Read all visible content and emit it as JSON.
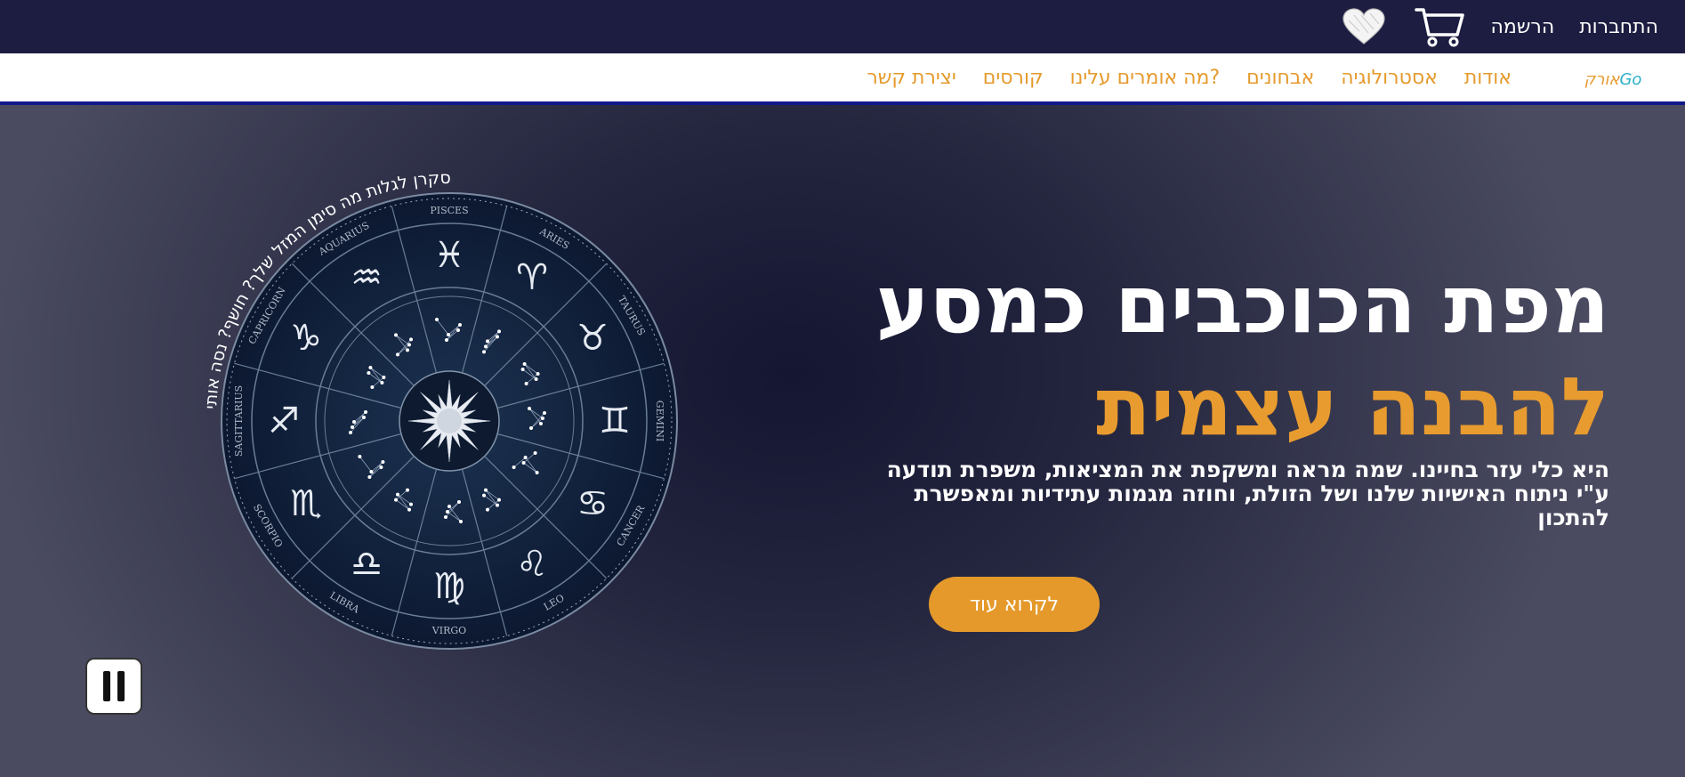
{
  "topbar": {
    "login": "התחברות",
    "register": "הרשמה",
    "cart_icon": "cart-icon",
    "heart_icon": "heart-icon"
  },
  "navbar": {
    "logo_part1": "אורק",
    "logo_part2": "Go",
    "items": [
      "אודות",
      "אסטרולוגיה",
      "אבחונים",
      "מה אומרים עלינו?",
      "קורסים",
      "יצירת קשר"
    ]
  },
  "hero": {
    "title_line1": "מפת הכוכבים כמסע",
    "title_line2": "להבנה עצמית",
    "description": "היא כלי עזר בחיינו. שמה מראה ומשקפת את המציאות, משפרת תודעה ע\"י ניתוח האישיות שלנו ושל הזולת, וחוזה מגמות עתידיות ומאפשרת להתכון",
    "read_more": "לקרוא עוד",
    "wheel_caption": "סקרן לגלות מה סימן המזל שלך? חושף? נסה אותי",
    "zodiac_signs": [
      "PISCES",
      "ARIES",
      "TAURUS",
      "GEMINI",
      "CANCER",
      "LEO",
      "VIRGO",
      "LIBRA",
      "SCORPIO",
      "SAGITTARIUS",
      "CAPRICORN",
      "AQUARIUS"
    ],
    "zodiac_glyphs": [
      "♓",
      "♈",
      "♉",
      "♊",
      "♋",
      "♌",
      "♍",
      "♎",
      "♏",
      "♐",
      "♑",
      "♒"
    ]
  },
  "controls": {
    "pause_icon": "pause-icon"
  },
  "colors": {
    "topbar_bg": "#1d1d42",
    "accent_orange": "#e89b2f",
    "nav_border": "#12188a",
    "wheel_bg": "#0e1a33"
  }
}
